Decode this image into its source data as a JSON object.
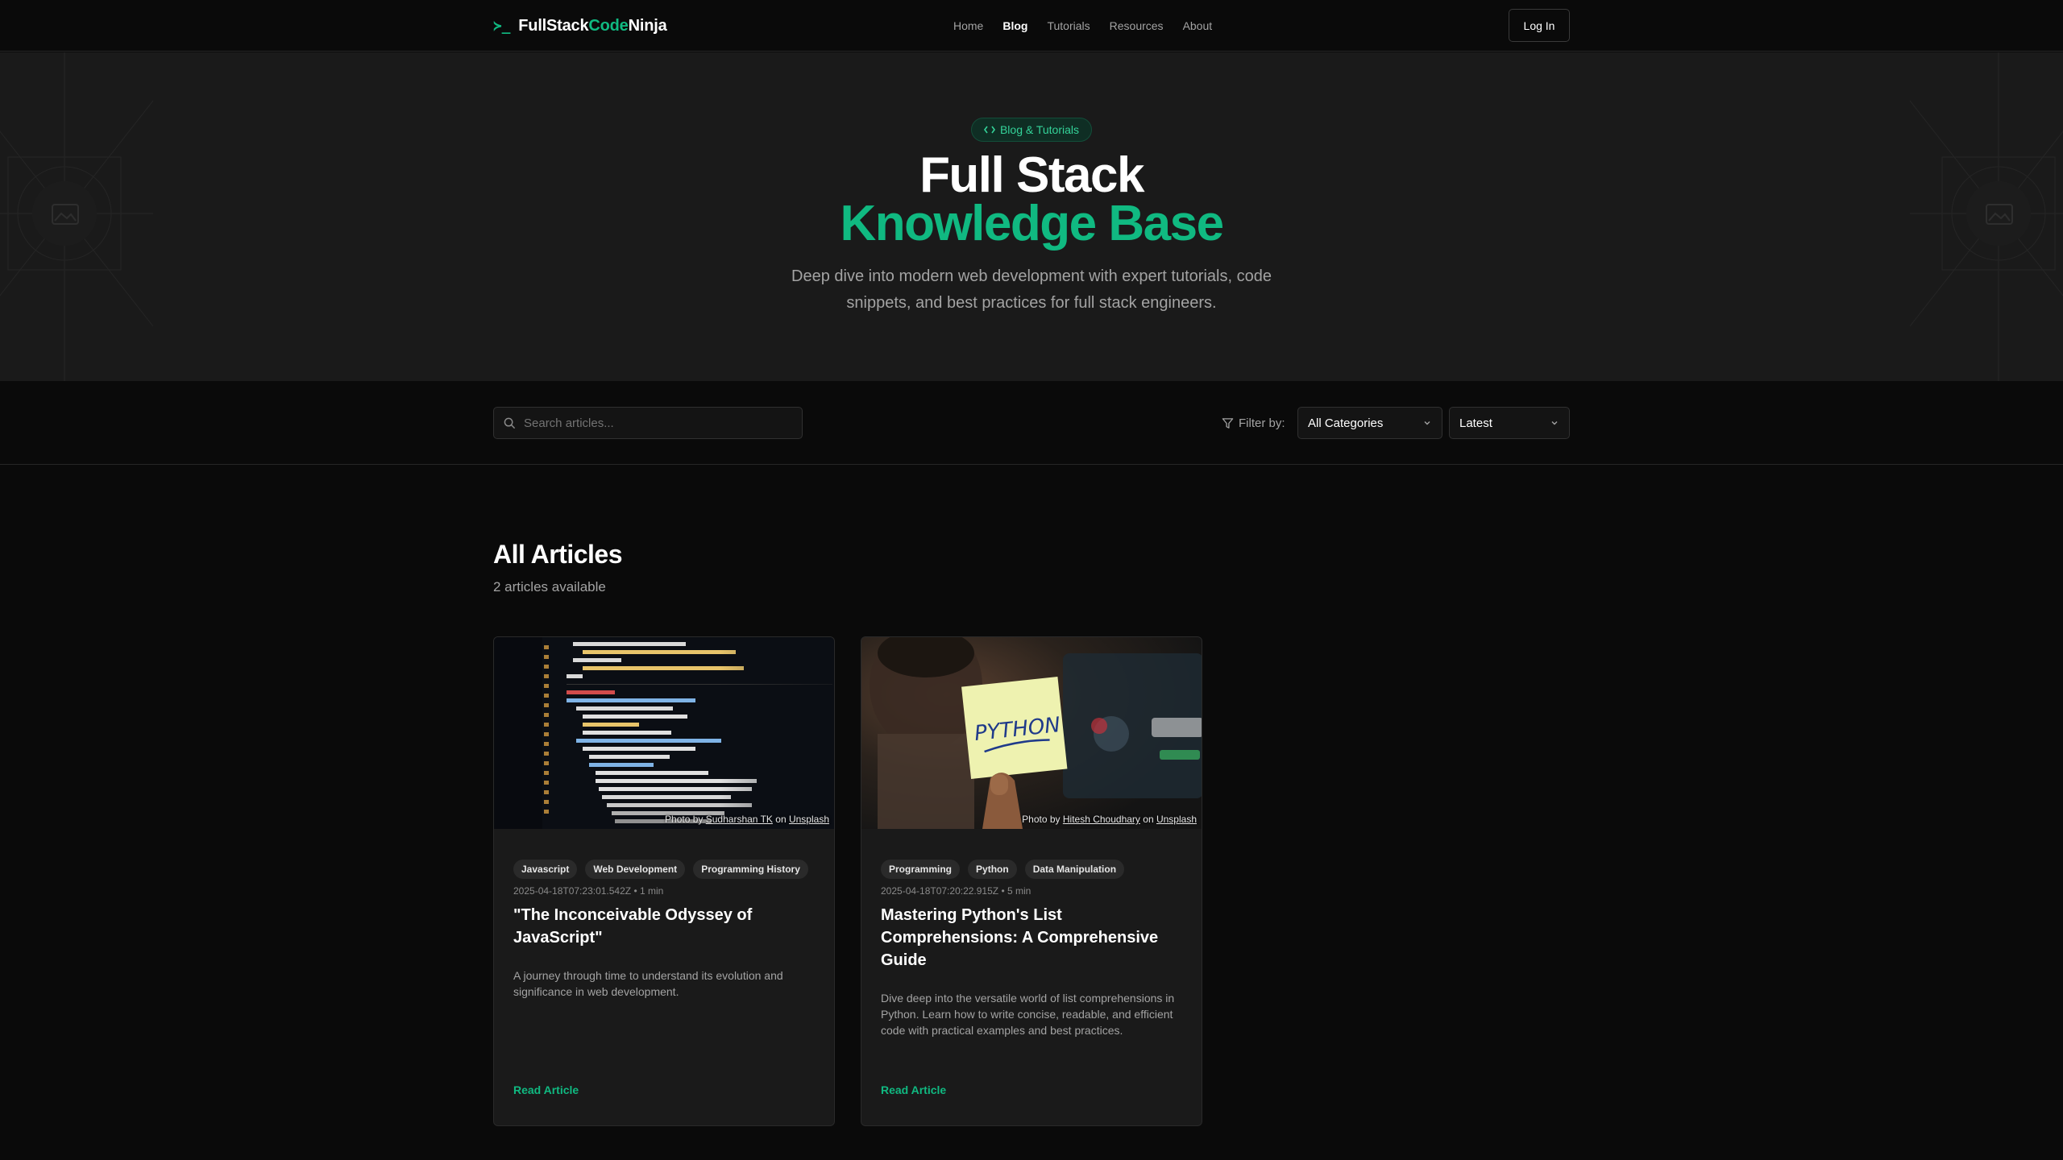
{
  "nav": {
    "brand": {
      "prompt": "≻_",
      "part1": "Full",
      "part2": "Stack",
      "part3": "Code",
      "part4": "Ninja"
    },
    "links": [
      "Home",
      "Blog",
      "Tutorials",
      "Resources",
      "About"
    ],
    "active": "Blog",
    "login_label": "Log In"
  },
  "hero": {
    "badge": "Blog & Tutorials",
    "title_line1": "Full Stack",
    "title_line2": "Knowledge Base",
    "description": "Deep dive into modern web development with expert tutorials, code snippets, and best practices for full stack engineers."
  },
  "filters": {
    "search_placeholder": "Search articles...",
    "filter_label": "Filter by:",
    "category_value": "All Categories",
    "sort_value": "Latest"
  },
  "articles_section": {
    "title": "All Articles",
    "count_text": "2 articles available"
  },
  "articles": [
    {
      "tags": [
        "Javascript",
        "Web Development",
        "Programming History"
      ],
      "meta": "2025-04-18T07:23:01.542Z • 1 min",
      "title": "\"The Inconceivable Odyssey of JavaScript\"",
      "description": "A journey through time to understand its evolution and significance in web development.",
      "credit_prefix": "Photo by",
      "credit_author": "Sudharshan TK",
      "credit_on": "on",
      "credit_site": "Unsplash",
      "read_label": "Read Article"
    },
    {
      "tags": [
        "Programming",
        "Python",
        "Data Manipulation"
      ],
      "meta": "2025-04-18T07:20:22.915Z • 5 min",
      "title": "Mastering Python's List Comprehensions: A Comprehensive Guide",
      "description": "Dive deep into the versatile world of list comprehensions in Python. Learn how to write concise, readable, and efficient code with practical examples and best practices.",
      "credit_prefix": "Photo by",
      "credit_author": "Hitesh Choudhary",
      "credit_on": "on",
      "credit_site": "Unsplash",
      "sticky_note_text": "PYTHON",
      "read_label": "Read Article"
    }
  ],
  "colors": {
    "accent": "#10b981",
    "background": "#0a0a0a",
    "hero_bg": "#1a1a1a"
  },
  "icons": {
    "brand": "terminal-prompt-icon",
    "search": "search-icon",
    "filter": "filter-icon",
    "select": "chevron-down-icon",
    "badge": "code-brackets-icon",
    "deco": "image-placeholder-icon"
  }
}
